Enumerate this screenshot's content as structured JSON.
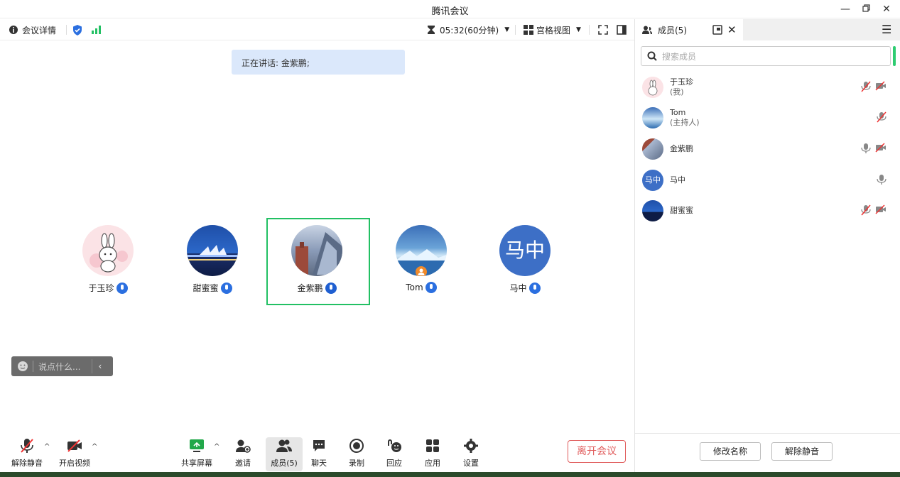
{
  "window": {
    "title": "腾讯会议"
  },
  "topbar": {
    "meeting_details": "会议详情",
    "timer": "05:32(60分钟)",
    "view_mode": "宫格视图"
  },
  "speaking": {
    "text": "正在讲话: 金紫鹏;"
  },
  "participants": [
    {
      "name": "于玉珍"
    },
    {
      "name": "甜蜜蜜"
    },
    {
      "name": "金紫鹏"
    },
    {
      "name": "Tom"
    },
    {
      "name": "马中",
      "avatar_text": "马中"
    }
  ],
  "chat": {
    "placeholder": "说点什么..."
  },
  "bottombar": {
    "unmute": "解除静音",
    "start_video": "开启视频",
    "share_screen": "共享屏幕",
    "invite": "邀请",
    "members": "成员(5)",
    "chat": "聊天",
    "record": "录制",
    "react": "回应",
    "apps": "应用",
    "settings": "设置",
    "leave": "离开会议"
  },
  "panel": {
    "tab_label": "成员(5)",
    "search_placeholder": "搜索成员",
    "members": [
      {
        "name": "于玉珍",
        "sub": "(我)"
      },
      {
        "name": "Tom",
        "sub": "(主持人)"
      },
      {
        "name": "金紫鹏",
        "sub": ""
      },
      {
        "name": "马中",
        "sub": "",
        "avatar_text": "马中"
      },
      {
        "name": "甜蜜蜜",
        "sub": ""
      }
    ],
    "rename": "修改名称",
    "unmute": "解除静音"
  },
  "colors": {
    "accent": "#2b6fe0",
    "active_green": "#22c063",
    "leave_red": "#e05a5a"
  }
}
